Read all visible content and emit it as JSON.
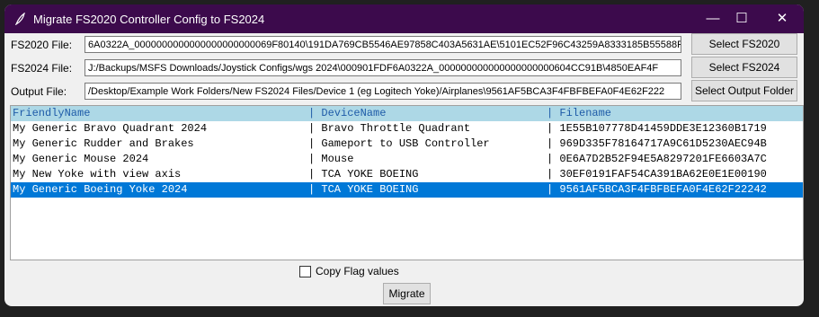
{
  "window": {
    "title": "Migrate FS2020 Controller Config to FS2024",
    "icon": "feather-icon",
    "controls": {
      "minimize": "—",
      "maximize": "☐",
      "close": "✕"
    }
  },
  "fields": [
    {
      "label": "FS2020 File:",
      "value": "6A0322A_0000000000000000000000069F80140\\191DA769CB5546AE97858C403A5631AE\\5101EC52F96C43259A8333185B55588F",
      "button": "Select FS2020 Folder"
    },
    {
      "label": "FS2024 File:",
      "value": "J:/Backups/MSFS Downloads/Joystick Configs/wgs 2024\\000901FDF6A0322A_000000000000000000000604CC91B\\4850EAF4F",
      "button": "Select FS2024 Folder"
    },
    {
      "label": "Output File:",
      "value": "/Desktop/Example Work Folders/New FS2024 Files/Device 1 (eg Logitech Yoke)/Airplanes\\9561AF5BCA3F4FBFBEFA0F4E62F222",
      "button": "Select Output Folder"
    }
  ],
  "list": {
    "headers": [
      "FriendlyName",
      "| DeviceName",
      "| Filename"
    ],
    "rows": [
      [
        "My Generic Bravo Quadrant 2024",
        "| Bravo Throttle Quadrant",
        "| 1E55B107778D41459DDE3E12360B1719"
      ],
      [
        "My Generic Rudder and Brakes",
        "| Gameport to USB Controller",
        "| 969D335F78164717A9C61D5230AEC94B"
      ],
      [
        "My Generic Mouse 2024",
        "| Mouse",
        "| 0E6A7D2B52F94E5A8297201FE6603A7C"
      ],
      [
        "My New Yoke with view axis",
        "| TCA YOKE BOEING",
        "| 30EF0191FAF54CA391BA62E0E1E00190"
      ],
      [
        "My Generic Boeing Yoke 2024",
        "| TCA YOKE BOEING",
        "| 9561AF5BCA3F4FBFBEFA0F4E62F22242"
      ]
    ],
    "selected_index": 4
  },
  "checkbox": {
    "label": "Copy Flag values",
    "checked": false
  },
  "migrate_button": "Migrate"
}
